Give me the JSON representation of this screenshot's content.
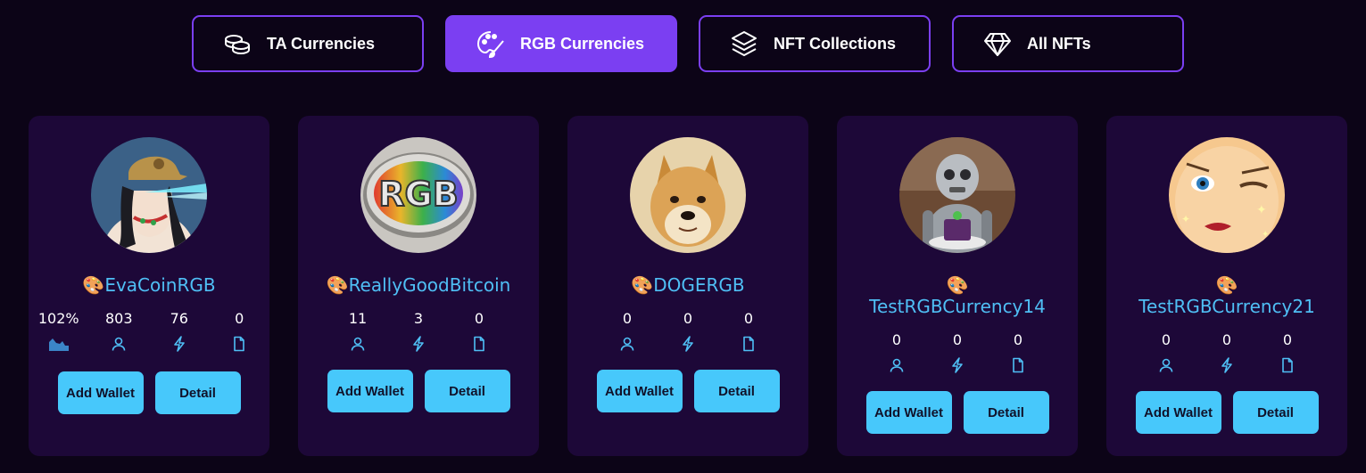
{
  "tabs": [
    {
      "label": "TA Currencies",
      "icon": "coins-icon",
      "active": false
    },
    {
      "label": "RGB Currencies",
      "icon": "palette-icon",
      "active": true
    },
    {
      "label": "NFT Collections",
      "icon": "layers-icon",
      "active": false
    },
    {
      "label": "All NFTs",
      "icon": "diamond-icon",
      "active": false
    }
  ],
  "colors": {
    "background": "#0c0417",
    "card": "#1d0838",
    "accent": "#7b3ff2",
    "name": "#4fbff5",
    "button": "#47c8fb"
  },
  "name_prefix": "🎨",
  "buttons": {
    "add_wallet": "Add Wallet",
    "detail": "Detail"
  },
  "cards": [
    {
      "name": "EvaCoinRGB",
      "avatar": "cartoon-woman-laser-eyes-avatar",
      "stats": [
        {
          "value": "102%",
          "icon": "chart-icon"
        },
        {
          "value": "803",
          "icon": "user-icon"
        },
        {
          "value": "76",
          "icon": "lightning-icon"
        },
        {
          "value": "0",
          "icon": "document-icon"
        }
      ]
    },
    {
      "name": "ReallyGoodBitcoin",
      "avatar": "rgb-coin-avatar",
      "stats": [
        {
          "value": "11",
          "icon": "user-icon"
        },
        {
          "value": "3",
          "icon": "lightning-icon"
        },
        {
          "value": "0",
          "icon": "document-icon"
        }
      ]
    },
    {
      "name": "DOGERGB",
      "avatar": "doge-avatar",
      "stats": [
        {
          "value": "0",
          "icon": "user-icon"
        },
        {
          "value": "0",
          "icon": "lightning-icon"
        },
        {
          "value": "0",
          "icon": "document-icon"
        }
      ]
    },
    {
      "name": "TestRGBCurrency14",
      "avatar": "robot-cake-avatar",
      "stats": [
        {
          "value": "0",
          "icon": "user-icon"
        },
        {
          "value": "0",
          "icon": "lightning-icon"
        },
        {
          "value": "0",
          "icon": "document-icon"
        }
      ]
    },
    {
      "name": "TestRGBCurrency21",
      "avatar": "winking-face-avatar",
      "stats": [
        {
          "value": "0",
          "icon": "user-icon"
        },
        {
          "value": "0",
          "icon": "lightning-icon"
        },
        {
          "value": "0",
          "icon": "document-icon"
        }
      ]
    }
  ]
}
